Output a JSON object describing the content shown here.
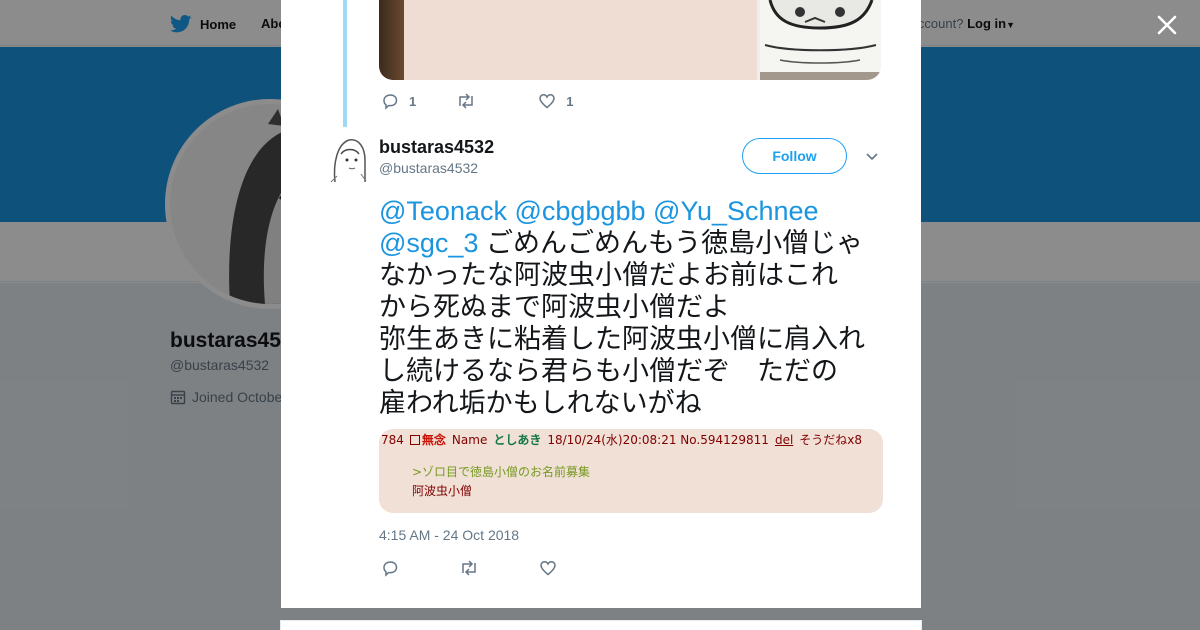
{
  "nav": {
    "home_label": "Home",
    "about_label": "Abo",
    "account_prompt": "account?",
    "login_label": "Log in"
  },
  "profile": {
    "name": "bustaras45",
    "handle": "@bustaras4532",
    "joined": "Joined Octobe"
  },
  "previous_tweet": {
    "reply_count": "1",
    "like_count": "1"
  },
  "tweet": {
    "author_name": "bustaras4532",
    "author_handle": "@bustaras4532",
    "follow_label": "Follow",
    "mentions": [
      "@Teonack",
      "@cbgbgbb",
      "@Yu_Schnee",
      "@sgc_3"
    ],
    "text_line_2": "ごめんごめんもう徳島小僧じゃ",
    "text_line_3": "なかったな阿波虫小僧だよお前はこれ",
    "text_line_4": "から死ぬまで阿波虫小僧だよ",
    "text_line_5": "弥生あきに粘着した阿波虫小僧に肩入れ",
    "text_line_6": "し続けるなら君らも小僧だぞ　ただの",
    "text_line_7": "雇われ垢かもしれないがね",
    "timestamp": "4:15 AM - 24 Oct 2018"
  },
  "media_card": {
    "post_number": "784",
    "subject": "無念",
    "name_label": "Name",
    "poster_name": "としあき",
    "post_meta": "18/10/24(水)20:08:21 No.594129811",
    "del_label": "del",
    "sodane": "そうだねx8",
    "quote_line": ">ゾロ目で徳島小僧のお名前募集",
    "body_line": "阿波虫小僧"
  },
  "colors": {
    "twitter_blue": "#1da1f2",
    "banner": "#1b95e0",
    "thread_line": "#a0d8f7",
    "card_background": "#f0e0d6"
  },
  "icons": {
    "nav_logo": "twitter-bird-icon",
    "close": "close-icon",
    "reply": "reply-icon",
    "retweet": "retweet-icon",
    "like": "heart-icon",
    "more": "chevron-down-icon",
    "calendar": "calendar-icon"
  }
}
